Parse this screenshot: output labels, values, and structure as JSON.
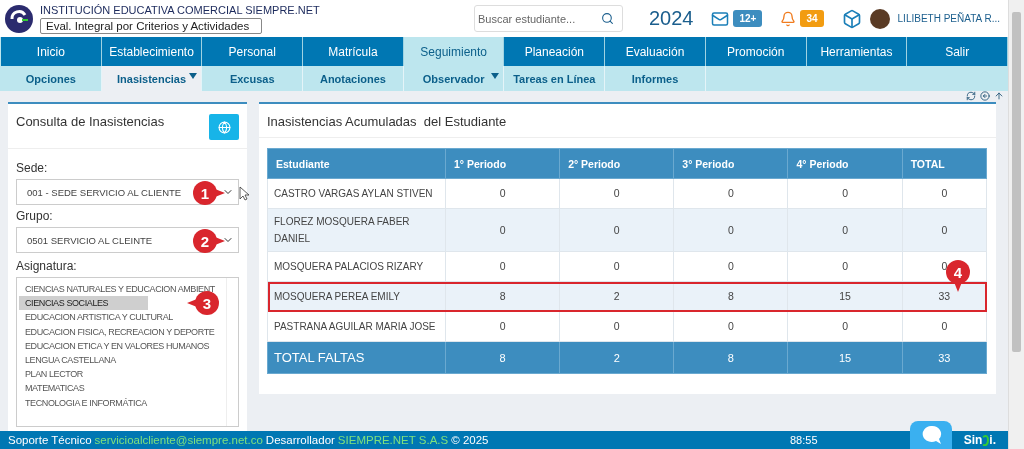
{
  "header": {
    "school": "INSTITUCIÓN EDUCATIVA COMERCIAL SIEMPRE.NET",
    "mode_select": "Eval. Integral por Criterios y Actividades",
    "search": {
      "placeholder": "Buscar estudiante..."
    },
    "year": "2024",
    "messages_badge": "12+",
    "alerts_badge": "34",
    "user_name": "LILIBETH PEÑATA R..."
  },
  "main_nav": [
    {
      "label": "Inicio",
      "selected": false
    },
    {
      "label": "Establecimiento",
      "selected": false
    },
    {
      "label": "Personal",
      "selected": false
    },
    {
      "label": "Matrícula",
      "selected": false
    },
    {
      "label": "Seguimiento",
      "selected": true
    },
    {
      "label": "Planeación",
      "selected": false
    },
    {
      "label": "Evaluación",
      "selected": false
    },
    {
      "label": "Promoción",
      "selected": false
    },
    {
      "label": "Herramientas",
      "selected": false
    },
    {
      "label": "Salir",
      "selected": false
    }
  ],
  "sub_nav": [
    {
      "label": "Opciones",
      "selected": false,
      "has_menu": false
    },
    {
      "label": "Inasistencias",
      "selected": true,
      "has_menu": true
    },
    {
      "label": "Excusas",
      "selected": false,
      "has_menu": false
    },
    {
      "label": "Anotaciones",
      "selected": false,
      "has_menu": false
    },
    {
      "label": "Observador",
      "selected": false,
      "has_menu": true
    },
    {
      "label": "Tareas en Línea",
      "selected": false,
      "has_menu": false
    },
    {
      "label": "Informes",
      "selected": false,
      "has_menu": false
    }
  ],
  "query_panel": {
    "title": "Consulta de Inasistencias",
    "fields": [
      {
        "label": "Sede:",
        "value": "001 - SEDE SERVICIO AL CLIENTE",
        "callout": "1"
      },
      {
        "label": "Grupo:",
        "value": "0501 SERVICIO AL CLEINTE",
        "callout": "2"
      }
    ],
    "subjects_label": "Asignatura:",
    "subjects_callout": "3",
    "subjects": [
      {
        "name": "CIENCIAS NATURALES Y EDUCACION AMBIENT",
        "selected": false
      },
      {
        "name": "CIENCIAS SOCIALES",
        "selected": true
      },
      {
        "name": "EDUCACION ARTISTICA Y CULTURAL",
        "selected": false
      },
      {
        "name": "EDUCACION FISICA, RECREACION Y DEPORTE",
        "selected": false
      },
      {
        "name": "EDUCACION ETICA Y EN VALORES HUMANOS",
        "selected": false
      },
      {
        "name": "LENGUA CASTELLANA",
        "selected": false
      },
      {
        "name": "PLAN LECTOR",
        "selected": false
      },
      {
        "name": "MATEMATICAS",
        "selected": false
      },
      {
        "name": "TECNOLOGIA E INFORMÁTICA",
        "selected": false
      }
    ]
  },
  "results_panel": {
    "title": "Inasistencias Acumuladas  del Estudiante",
    "callout": "4",
    "table": {
      "columns": [
        "Estudiante",
        "1° Periodo",
        "2° Periodo",
        "3° Periodo",
        "4° Periodo",
        "TOTAL"
      ],
      "rows": [
        {
          "cells": [
            "CASTRO VARGAS AYLAN STIVEN",
            "0",
            "0",
            "0",
            "0",
            "0"
          ],
          "highlighted": false
        },
        {
          "cells": [
            "FLOREZ MOSQUERA FABER DANIEL",
            "0",
            "0",
            "0",
            "0",
            "0"
          ],
          "highlighted": false
        },
        {
          "cells": [
            "MOSQUERA PALACIOS RIZARY",
            "0",
            "0",
            "0",
            "0",
            "0"
          ],
          "highlighted": false
        },
        {
          "cells": [
            "MOSQUERA PEREA EMILY",
            "8",
            "2",
            "8",
            "15",
            "33"
          ],
          "highlighted": true
        },
        {
          "cells": [
            "PASTRANA AGUILAR MARIA JOSE",
            "0",
            "0",
            "0",
            "0",
            "0"
          ],
          "highlighted": false
        }
      ],
      "total_row": [
        "TOTAL FALTAS",
        "8",
        "2",
        "8",
        "15",
        "33"
      ]
    }
  },
  "footer": {
    "support_label": "Soporte Técnico",
    "support_email": "servicioalcliente@siempre.net.co",
    "developer_label": "Desarrollador",
    "developer": "SIEMPRE.NET S.A.S",
    "copyright": "© 2025",
    "timer": "88:55",
    "brand_start": "Sin",
    "brand_end": "i."
  }
}
